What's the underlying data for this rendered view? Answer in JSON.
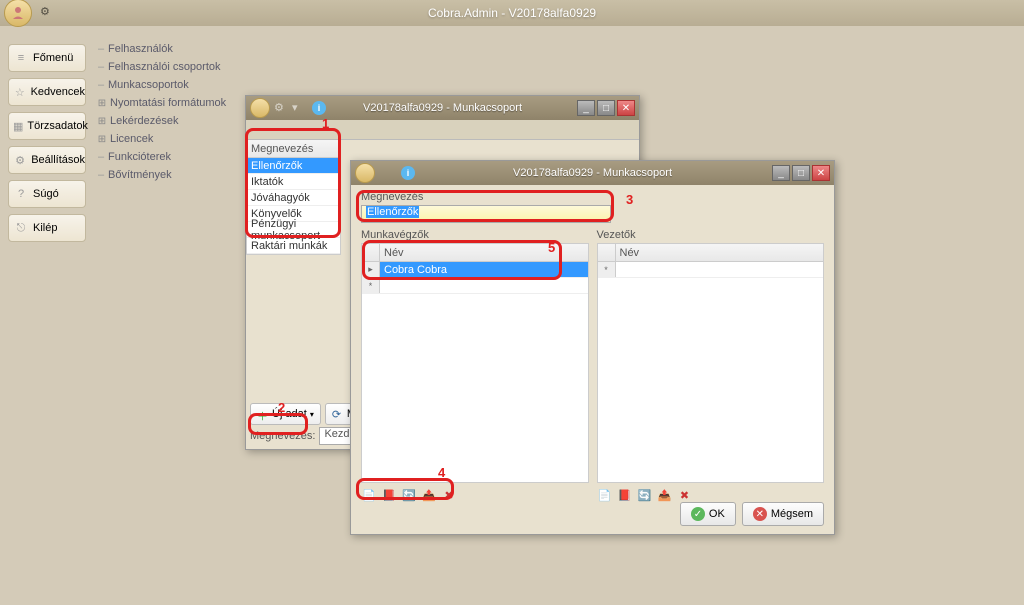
{
  "titlebar": {
    "caption": "Cobra.Admin - V20178alfa0929"
  },
  "sidebar": {
    "items": [
      {
        "label": "Főmenü"
      },
      {
        "label": "Kedvencek"
      },
      {
        "label": "Törzsadatok"
      },
      {
        "label": "Beállítások"
      },
      {
        "label": "Súgó"
      },
      {
        "label": "Kilép"
      }
    ]
  },
  "tree": {
    "items": [
      {
        "label": "Felhasználók",
        "expandable": false
      },
      {
        "label": "Felhasználói csoportok",
        "expandable": false
      },
      {
        "label": "Munkacsoportok",
        "expandable": false
      },
      {
        "label": "Nyomtatási formátumok",
        "expandable": true
      },
      {
        "label": "Lekérdezések",
        "expandable": true
      },
      {
        "label": "Licencek",
        "expandable": true
      },
      {
        "label": "Funkcióterek",
        "expandable": false
      },
      {
        "label": "Bővítmények",
        "expandable": false
      }
    ]
  },
  "dialog1": {
    "title": "V20178alfa0929 - Munkacsoport",
    "list_header": "Megnevezés",
    "rows": [
      {
        "label": "Ellenőrzők",
        "selected": true
      },
      {
        "label": "Iktatók",
        "selected": false
      },
      {
        "label": "Jóváhagyók",
        "selected": false
      },
      {
        "label": "Könyvelők",
        "selected": false
      },
      {
        "label": "Pénzügyi munkacsoport",
        "selected": false
      },
      {
        "label": "Raktári munkák",
        "selected": false
      }
    ],
    "btn_new": "Új adat",
    "btn_megny": "Megny",
    "filter_label": "Megnevezés:",
    "filter_mode": "Kezdődik"
  },
  "dialog2": {
    "title": "V20178alfa0929 - Munkacsoport",
    "field_label": "Megnevezés",
    "field_value": "Ellenőrzők",
    "section_left": "Munkavégzők",
    "section_right": "Vezetők",
    "grid_header": "Név",
    "left_rows": [
      {
        "label": "Cobra Cobra",
        "selected": true
      }
    ],
    "right_rows": [],
    "btn_ok": "OK",
    "btn_cancel": "Mégsem"
  },
  "callouts": {
    "n1": "1",
    "n2": "2",
    "n3": "3",
    "n4": "4",
    "n5": "5"
  }
}
